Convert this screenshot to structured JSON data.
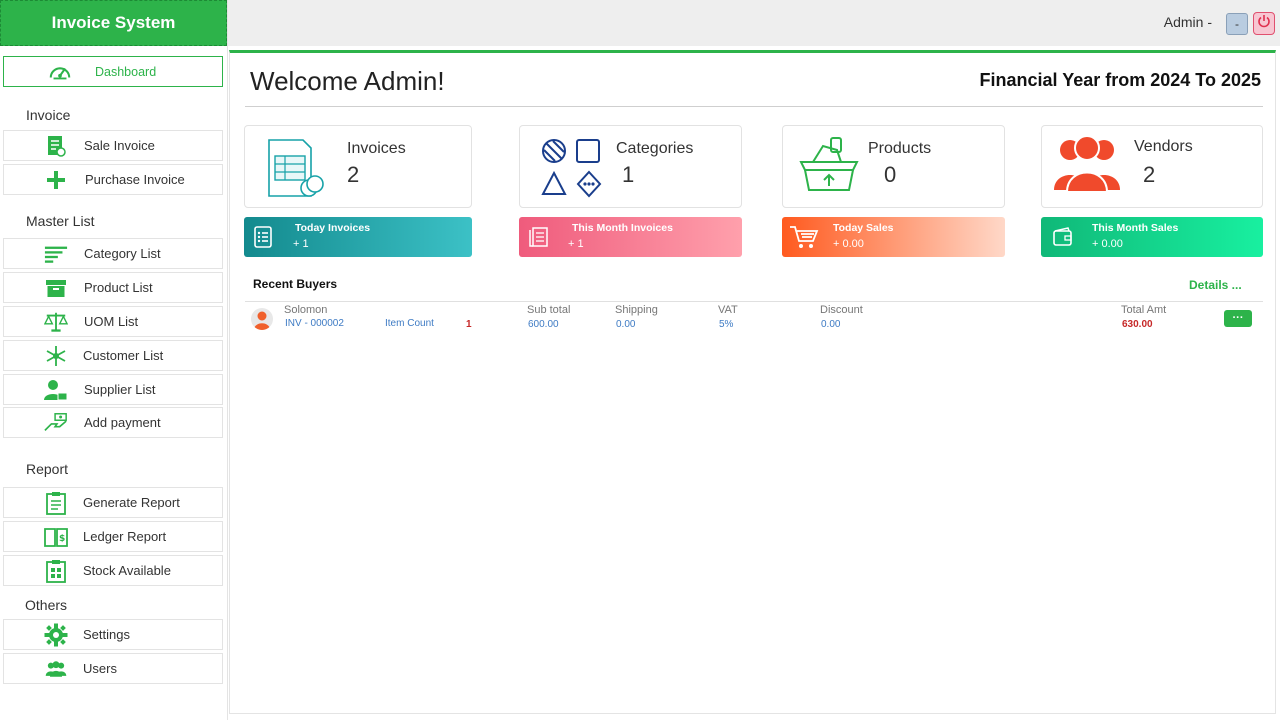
{
  "app": {
    "title": "Invoice System"
  },
  "sidebar": {
    "dashboard": "Dashboard",
    "sections": {
      "invoice": "Invoice",
      "master": "Master List",
      "report": "Report",
      "others": "Others"
    },
    "items": {
      "sale_invoice": "Sale Invoice",
      "purchase_invoice": "Purchase Invoice",
      "category_list": "Category List",
      "product_list": "Product List",
      "uom_list": "UOM List",
      "customer_list": "Customer List",
      "supplier_list": "Supplier List",
      "add_payment": "Add payment",
      "generate_report": "Generate Report",
      "ledger_report": "Ledger Report",
      "stock_available": "Stock Available",
      "settings": "Settings",
      "users": "Users"
    }
  },
  "topbar": {
    "user": "Admin -",
    "minimize": "-"
  },
  "main": {
    "welcome": "Welcome Admin!",
    "financial_year": "Financial Year from 2024 To 2025",
    "cards": {
      "invoices": {
        "title": "Invoices",
        "value": "2"
      },
      "categories": {
        "title": "Categories",
        "value": "1"
      },
      "products": {
        "title": "Products",
        "value": "0"
      },
      "vendors": {
        "title": "Vendors",
        "value": "2"
      }
    },
    "stats": {
      "today_invoices": {
        "title": "Today Invoices",
        "value": "+ 1"
      },
      "month_invoices": {
        "title": "This Month Invoices",
        "value": "+ 1"
      },
      "today_sales": {
        "title": "Today Sales",
        "value": "+ 0.00"
      },
      "month_sales": {
        "title": "This Month Sales",
        "value": "+ 0.00"
      }
    },
    "recent": {
      "title": "Recent Buyers",
      "details": "Details ...",
      "row": {
        "name": "Solomon",
        "invoice_no": "INV - 000002",
        "item_count_label": "Item Count",
        "item_count": "1",
        "subtotal_label": "Sub total",
        "subtotal": "600.00",
        "shipping_label": "Shipping",
        "shipping": "0.00",
        "vat_label": "VAT",
        "vat": "5%",
        "discount_label": "Discount",
        "discount": "0.00",
        "total_label": "Total Amt",
        "total": "630.00",
        "more": "···"
      }
    }
  },
  "colors": {
    "brand_green": "#2db34a",
    "teal": "#17a2a8",
    "pink": "#f06a86",
    "orange": "#ff6a2b",
    "green_bright": "#11d98a",
    "vendor_red": "#f04a2c"
  }
}
